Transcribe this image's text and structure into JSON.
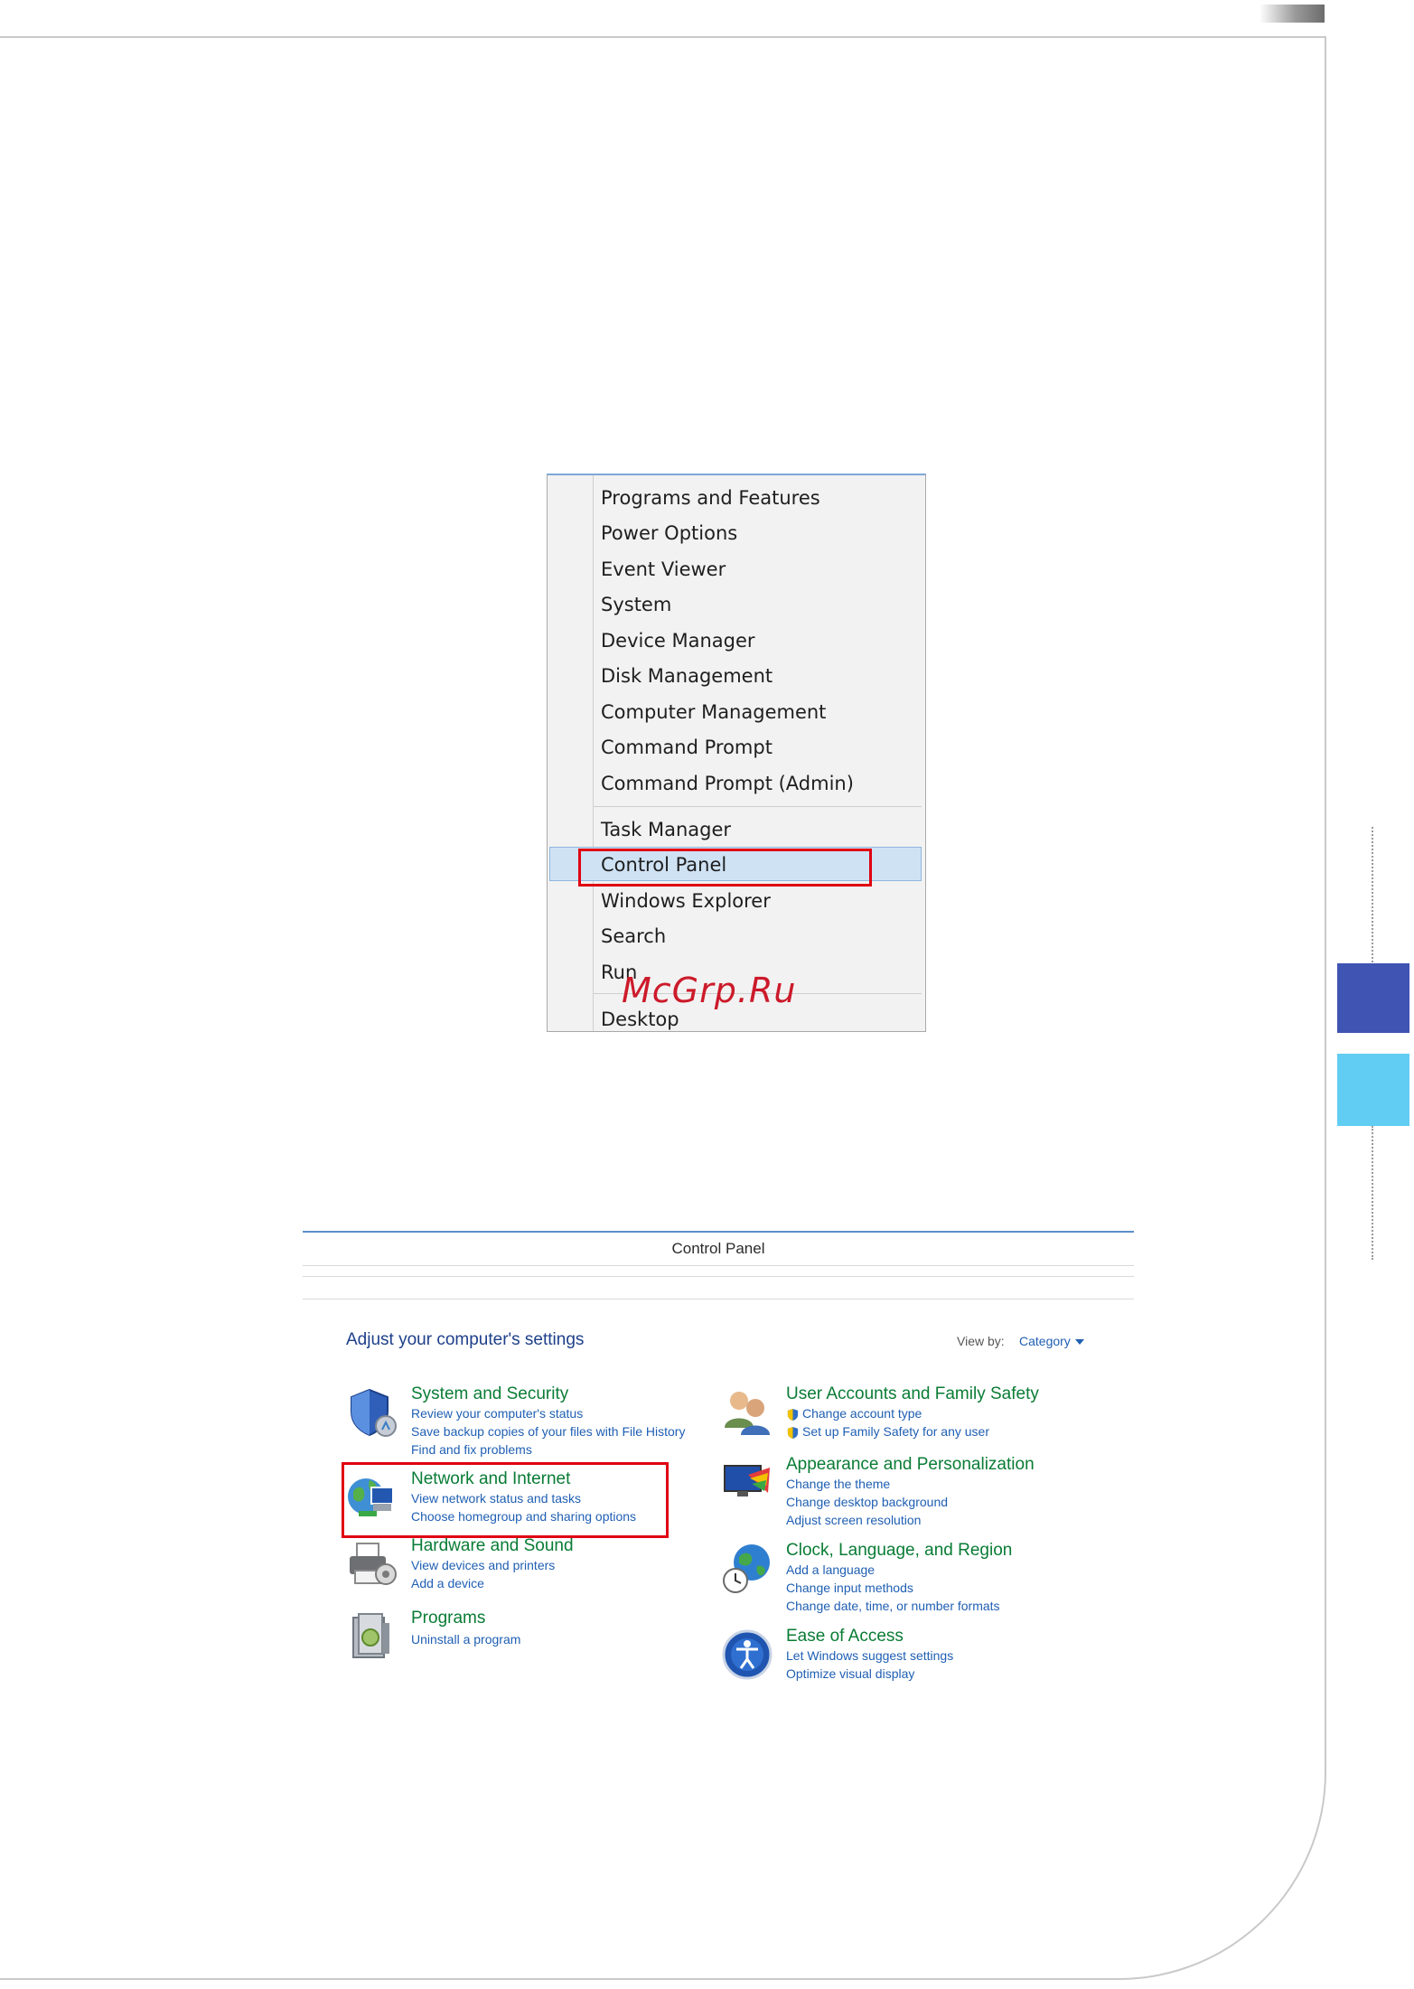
{
  "context_menu": {
    "items": [
      "Programs and Features",
      "Power Options",
      "Event Viewer",
      "System",
      "Device Manager",
      "Disk Management",
      "Computer Management",
      "Command Prompt",
      "Command Prompt (Admin)",
      "Task Manager",
      "Control Panel",
      "Windows Explorer",
      "Search",
      "Run",
      "Desktop"
    ],
    "highlighted_item": "Control Panel"
  },
  "watermark": "McGrp.Ru",
  "control_panel": {
    "title": "Control Panel",
    "heading": "Adjust your computer's settings",
    "view_by_label": "View by:",
    "view_by_value": "Category",
    "categories": [
      {
        "title": "System and Security",
        "icon": "shield-icon",
        "links": [
          "Review your computer's status",
          "Save backup copies of your files with File History",
          "Find and fix problems"
        ]
      },
      {
        "title": "Network and Internet",
        "icon": "network-globe-icon",
        "links": [
          "View network status and tasks",
          "Choose homegroup and sharing options"
        ]
      },
      {
        "title": "Hardware and Sound",
        "icon": "printer-icon",
        "links": [
          "View devices and printers",
          "Add a device"
        ]
      },
      {
        "title": "Programs",
        "icon": "programs-icon",
        "links": [
          "Uninstall a program"
        ]
      },
      {
        "title": "User Accounts and Family Safety",
        "icon": "users-icon",
        "links": [
          "Change account type",
          "Set up Family Safety for any user"
        ]
      },
      {
        "title": "Appearance and Personalization",
        "icon": "monitor-paint-icon",
        "links": [
          "Change the theme",
          "Change desktop background",
          "Adjust screen resolution"
        ]
      },
      {
        "title": "Clock, Language, and Region",
        "icon": "clock-globe-icon",
        "links": [
          "Add a language",
          "Change input methods",
          "Change date, time, or number formats"
        ]
      },
      {
        "title": "Ease of Access",
        "icon": "ease-of-access-icon",
        "links": [
          "Let Windows suggest settings",
          "Optimize visual display"
        ]
      }
    ]
  },
  "colors": {
    "highlight_box": "#e00012",
    "side_block_dark": "#3f54b3",
    "side_block_light": "#62cdf2",
    "category_title": "#0a7c35",
    "link": "#1f5fb3"
  }
}
